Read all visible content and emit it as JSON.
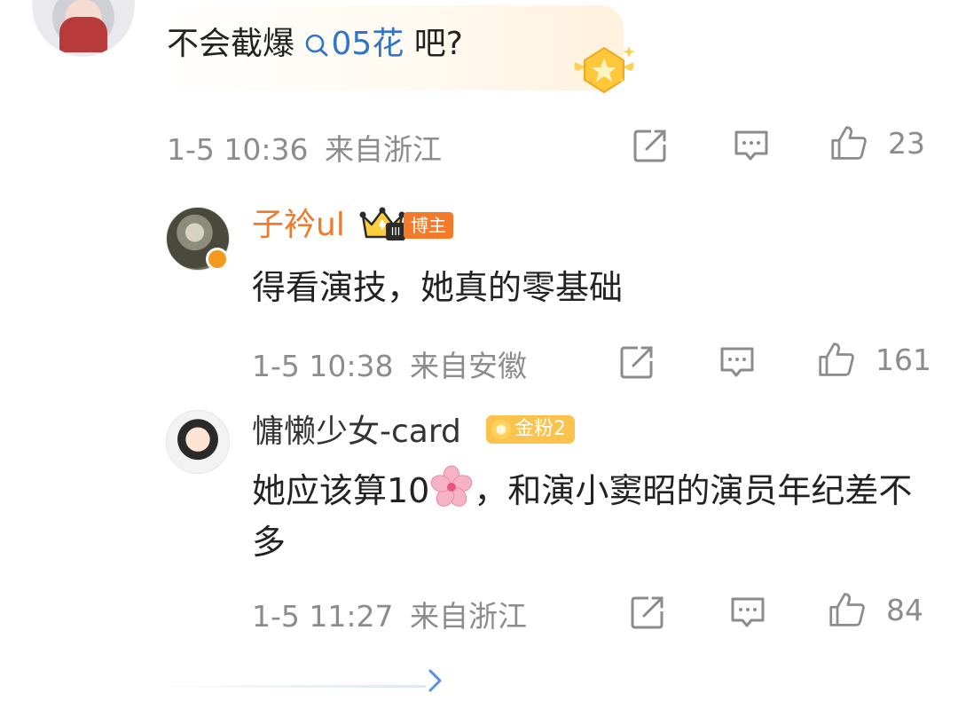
{
  "top_comment": {
    "text_before": "不会截爆",
    "topic": "05花",
    "text_after": " 吧?",
    "time": "1-5 10:36",
    "location": "来自浙江",
    "likes": "23"
  },
  "replies": [
    {
      "nickname": "子衿ul",
      "badge_label": "博主",
      "crown_level": "III",
      "text": "得看演技，她真的零基础",
      "time": "1-5 10:38",
      "location": "来自安徽",
      "likes": "161"
    },
    {
      "nickname": "慵懒少女-card",
      "badge_label": "金粉2",
      "text_before": "她应该算10",
      "text_after": "，和演小窦昭的演员年纪差不多",
      "time": "1-5 11:27",
      "location": "来自浙江",
      "likes": "84"
    }
  ],
  "colors": {
    "accent_topic": "#2f74c9",
    "blogger_name": "#ef7a2a",
    "meta_gray": "#8c8c8c",
    "fans_badge": "#fbc24d"
  }
}
